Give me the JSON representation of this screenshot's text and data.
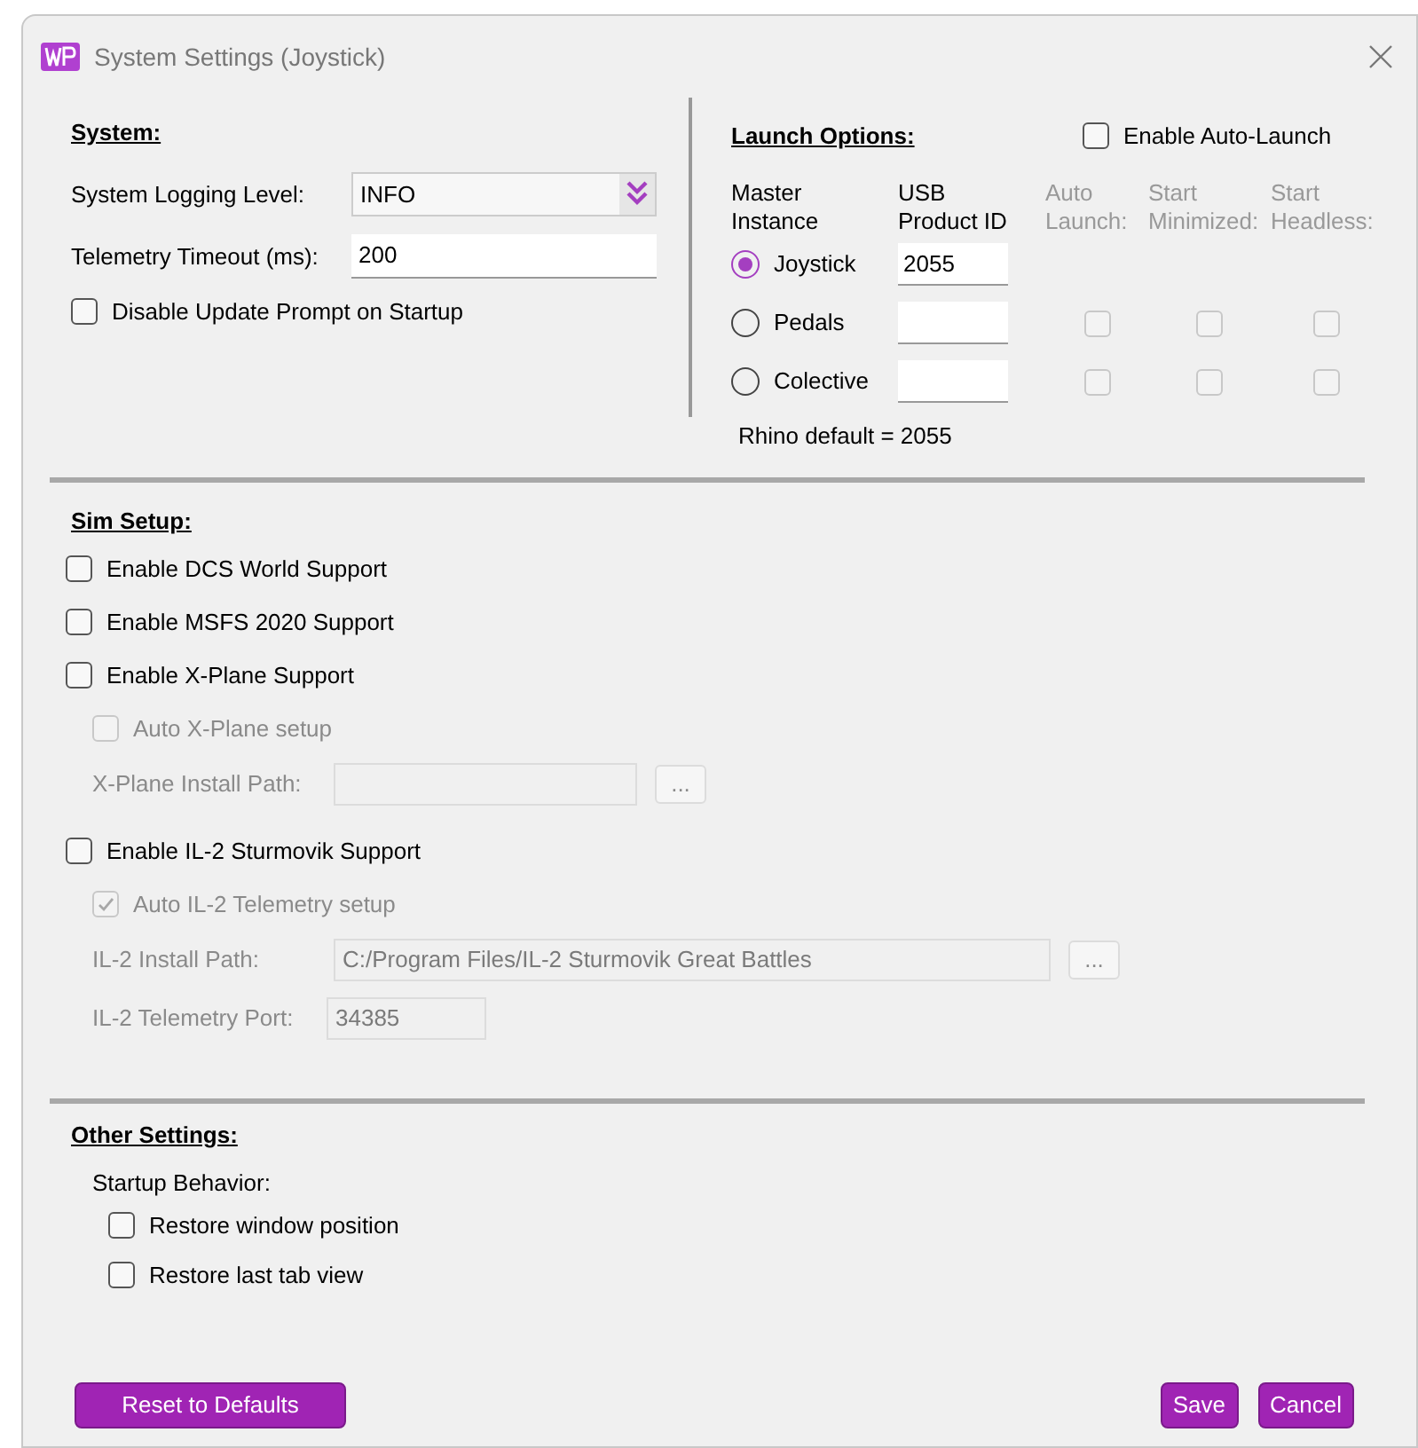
{
  "window": {
    "title": "System Settings (Joystick)"
  },
  "system": {
    "heading": "System:",
    "logging_level": {
      "label": "System Logging Level:",
      "value": "INFO"
    },
    "telemetry_timeout": {
      "label": "Telemetry Timeout (ms):",
      "value": "200"
    },
    "disable_update_prompt": {
      "label": "Disable Update Prompt on Startup",
      "checked": false
    }
  },
  "launch_options": {
    "heading": "Launch Options:",
    "enable_auto_launch": {
      "label": "Enable Auto-Launch",
      "checked": false
    },
    "columns": [
      {
        "label": "Master Instance",
        "disabled": false
      },
      {
        "label": "USB Product ID",
        "disabled": false
      },
      {
        "label": "Auto Launch:",
        "disabled": true
      },
      {
        "label": "Start Minimized:",
        "disabled": true
      },
      {
        "label": "Start Headless:",
        "disabled": true
      }
    ],
    "instances": [
      {
        "label": "Joystick",
        "selected": true,
        "product_id": "2055"
      },
      {
        "label": "Pedals",
        "selected": false,
        "options": [
          {
            "checked": false,
            "disabled": true
          },
          {
            "checked": false,
            "disabled": true
          },
          {
            "checked": false,
            "disabled": true
          }
        ]
      },
      {
        "label": "Colective",
        "selected": false,
        "options": [
          {
            "checked": false,
            "disabled": true
          },
          {
            "checked": false,
            "disabled": true
          },
          {
            "checked": false,
            "disabled": true
          }
        ]
      }
    ],
    "note": "Rhino default = 2055"
  },
  "sim_setup": {
    "heading": "Sim Setup:",
    "items": [
      {
        "kind": "checkbox",
        "label": "Enable DCS World Support",
        "checked": false,
        "disabled": false
      },
      {
        "kind": "checkbox",
        "label": "Enable MSFS 2020 Support",
        "checked": false,
        "disabled": false
      },
      {
        "kind": "checkbox",
        "label": "Enable X-Plane Support",
        "checked": false,
        "disabled": false,
        "children": [
          {
            "kind": "checkbox",
            "label": "Auto X-Plane setup",
            "checked": false,
            "disabled": true
          },
          {
            "kind": "path",
            "label": "X-Plane Install Path:",
            "browse": "...",
            "disabled": true
          }
        ]
      },
      {
        "kind": "checkbox",
        "label": "Enable IL-2 Sturmovik Support",
        "checked": false,
        "disabled": false,
        "children": [
          {
            "kind": "checkbox",
            "label": "Auto IL-2 Telemetry setup",
            "checked": true,
            "disabled": true
          },
          {
            "kind": "path",
            "label": "IL-2 Install Path:",
            "value": "C:/Program Files/IL-2 Sturmovik Great Battles",
            "browse": "...",
            "disabled": true
          },
          {
            "kind": "field",
            "label": "IL-2 Telemetry Port:",
            "value": "34385",
            "disabled": true
          }
        ]
      }
    ]
  },
  "other_settings": {
    "heading": "Other Settings:",
    "group_label": "Startup Behavior:",
    "items": [
      {
        "label": "Restore window position",
        "checked": false
      },
      {
        "label": "Restore last tab view",
        "checked": false
      }
    ]
  },
  "buttons": {
    "reset": "Reset to Defaults",
    "save": "Save",
    "cancel": "Cancel"
  }
}
